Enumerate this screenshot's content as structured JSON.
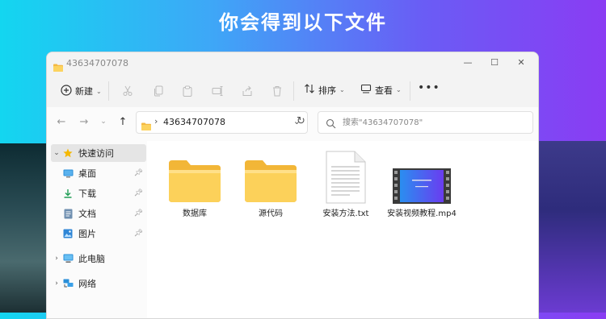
{
  "banner": {
    "text": "你会得到以下文件"
  },
  "window": {
    "title": "43634707078",
    "controls": {
      "minimize": "—",
      "maximize": "☐",
      "close": "✕"
    }
  },
  "toolbar": {
    "new_label": "新建",
    "sort_label": "排序",
    "view_label": "查看",
    "more": "•••"
  },
  "address": {
    "path": "43634707078",
    "separator": "›"
  },
  "search": {
    "placeholder": "搜索\"43634707078\""
  },
  "sidebar": {
    "quick_access": "快速访问",
    "items": [
      {
        "label": "桌面",
        "icon": "desktop-icon"
      },
      {
        "label": "下载",
        "icon": "download-icon"
      },
      {
        "label": "文档",
        "icon": "document-icon"
      },
      {
        "label": "图片",
        "icon": "picture-icon"
      }
    ],
    "this_pc": "此电脑",
    "network": "网络"
  },
  "files": [
    {
      "name": "数据库",
      "type": "folder"
    },
    {
      "name": "源代码",
      "type": "folder"
    },
    {
      "name": "安装方法.txt",
      "type": "text"
    },
    {
      "name": "安装视频教程.mp4",
      "type": "video"
    }
  ],
  "colors": {
    "folder": "#f7c948",
    "accent": "#0067c0",
    "star": "#f5b800"
  }
}
